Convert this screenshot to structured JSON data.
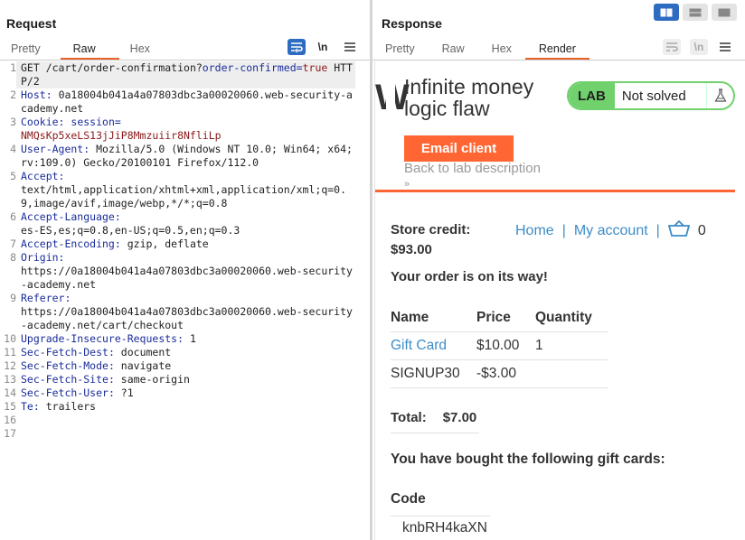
{
  "request": {
    "title": "Request",
    "tabs": [
      "Pretty",
      "Raw",
      "Hex"
    ],
    "active_tab": "Raw",
    "newline_btn": "\\n",
    "line_numbers": [
      "1",
      "2",
      "3",
      "4",
      "5",
      "6",
      "7",
      "8",
      "9",
      "10",
      "11",
      "12",
      "13",
      "14",
      "15",
      "16",
      "17"
    ],
    "lines": [
      {
        "method": "GET",
        "path": " /cart/order-confirmation?",
        "param": "order-confirmed",
        "eq": "=",
        "val": "true",
        "proto": " HTTP/2"
      },
      {
        "key": "Host",
        "value": "0a18004b041a4a07803dbc3a00020060.web-security-academy.net"
      },
      {
        "key": "Cookie",
        "ckey": "session",
        "cval": "NMQsKp5xeLS13jJiP8Mmzuiir8NfliLp"
      },
      {
        "key": "User-Agent",
        "value": "Mozilla/5.0 (Windows NT 10.0; Win64; x64; rv:109.0) Gecko/20100101 Firefox/112.0"
      },
      {
        "key": "Accept",
        "value": "text/html,application/xhtml+xml,application/xml;q=0.9,image/avif,image/webp,*/*;q=0.8"
      },
      {
        "key": "Accept-Language",
        "value": "es-ES,es;q=0.8,en-US;q=0.5,en;q=0.3"
      },
      {
        "key": "Accept-Encoding",
        "value": "gzip, deflate"
      },
      {
        "key": "Origin",
        "value": "https://0a18004b041a4a07803dbc3a00020060.web-security-academy.net"
      },
      {
        "key": "Referer",
        "value": "https://0a18004b041a4a07803dbc3a00020060.web-security-academy.net/cart/checkout"
      },
      {
        "key": "Upgrade-Insecure-Requests",
        "value": "1"
      },
      {
        "key": "Sec-Fetch-Dest",
        "value": "document"
      },
      {
        "key": "Sec-Fetch-Mode",
        "value": "navigate"
      },
      {
        "key": "Sec-Fetch-Site",
        "value": "same-origin"
      },
      {
        "key": "Sec-Fetch-User",
        "value": "?1"
      },
      {
        "key": "Te",
        "value": "trailers"
      }
    ]
  },
  "response": {
    "title": "Response",
    "tabs": [
      "Pretty",
      "Raw",
      "Hex",
      "Render"
    ],
    "active_tab": "Render",
    "newline_btn": "\\n"
  },
  "lab": {
    "logo_fragment": "W",
    "title": "Infinite money logic flaw",
    "badge_label": "LAB",
    "status": "Not solved",
    "email_client": "Email client",
    "back_link": "Back to lab description",
    "arrows": "»"
  },
  "page": {
    "store_credit_label": "Store credit:",
    "store_credit_value": "$93.00",
    "nav_home": "Home",
    "nav_sep": "|",
    "nav_account": "My account",
    "cart_count": "0",
    "order_msg": "Your order is on its way!",
    "table_headers": [
      "Name",
      "Price",
      "Quantity"
    ],
    "rows": [
      {
        "name": "Gift Card",
        "price": "$10.00",
        "qty": "1"
      },
      {
        "name": "SIGNUP30",
        "price": "-$3.00",
        "qty": ""
      }
    ],
    "total_label": "Total:",
    "total_value": "$7.00",
    "gift_msg": "You have bought the following gift cards:",
    "code_header": "Code",
    "code_value": "knbRH4kaXN"
  },
  "colors": {
    "accent": "#e8622a",
    "lab_orange": "#ff6633",
    "lab_green": "#70d16d",
    "link_blue": "#3c8cc8",
    "header_key": "#1b2d9b",
    "cookie_value": "#8b1a1a",
    "layout_active": "#2d6cc0"
  }
}
